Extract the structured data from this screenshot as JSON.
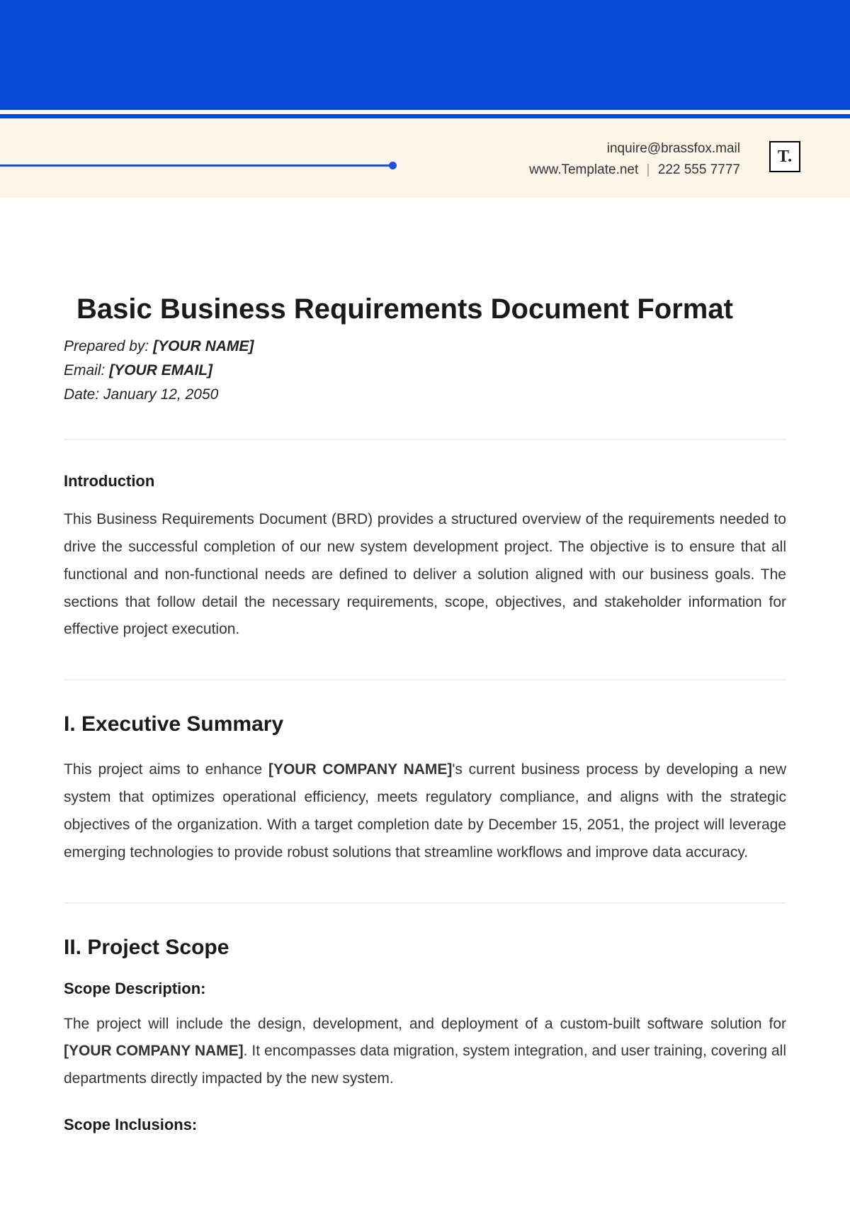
{
  "header": {
    "email": "inquire@brassfox.mail",
    "website": "www.Template.net",
    "phone": "222 555 7777",
    "logo_text": "T."
  },
  "document": {
    "title": "Basic Business Requirements Document Format",
    "prepared_by_label": "Prepared by: ",
    "prepared_by_value": "[YOUR NAME]",
    "email_label": "Email: ",
    "email_value": "[YOUR EMAIL]",
    "date_label": "Date: ",
    "date_value": "January 12, 2050"
  },
  "intro": {
    "heading": "Introduction",
    "body": "This Business Requirements Document (BRD) provides a structured overview of the requirements needed to drive the successful completion of our new system development project. The objective is to ensure that all functional and non-functional needs are defined to deliver a solution aligned with our business goals. The sections that follow detail the necessary requirements, scope, objectives, and stakeholder information for effective project execution."
  },
  "exec_summary": {
    "heading": "I. Executive Summary",
    "body_pre": "This project aims to enhance ",
    "company_placeholder": "[YOUR COMPANY NAME]",
    "body_post": "'s current business process by developing a new system that optimizes operational efficiency, meets regulatory compliance, and aligns with the strategic objectives of the organization. With a target completion date by December 15, 2051, the project will leverage emerging technologies to provide robust solutions that streamline workflows and improve data accuracy."
  },
  "scope": {
    "heading": "II. Project Scope",
    "description_label": "Scope Description:",
    "description_pre": "The project will include the design, development, and deployment of a custom-built software solution for ",
    "company_placeholder": "[YOUR COMPANY NAME]",
    "description_post": ". It encompasses data migration, system integration, and user training, covering all departments directly impacted by the new system.",
    "inclusions_label": "Scope Inclusions:"
  }
}
